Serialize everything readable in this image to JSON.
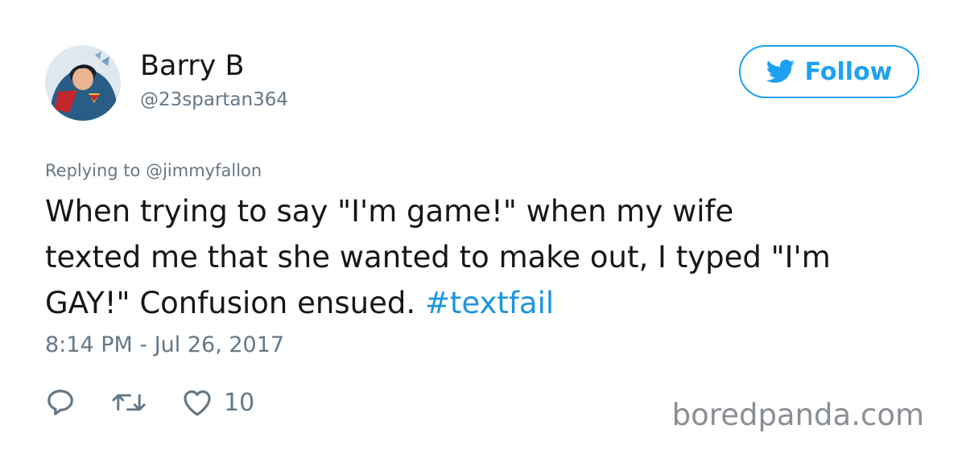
{
  "user": {
    "display_name": "Barry B",
    "handle": "@23spartan364"
  },
  "follow_button": {
    "label": "Follow",
    "icon": "twitter-bird-icon",
    "color": "#1da1f2"
  },
  "reply_context": {
    "prefix": "Replying to",
    "mention": "@jimmyfallon"
  },
  "tweet": {
    "text_lines": [
      "When trying to say \"I'm game!\" when my wife",
      "texted me that she wanted to make out, I typed \"I'm",
      "GAY!\" Confusion ensued."
    ],
    "hashtag": "#textfail",
    "timestamp": "8:14 PM - Jul 26, 2017"
  },
  "actions": {
    "reply_icon": "reply-icon",
    "retweet_icon": "retweet-icon",
    "like_icon": "heart-icon",
    "like_count": "10"
  },
  "watermark": "boredpanda.com"
}
